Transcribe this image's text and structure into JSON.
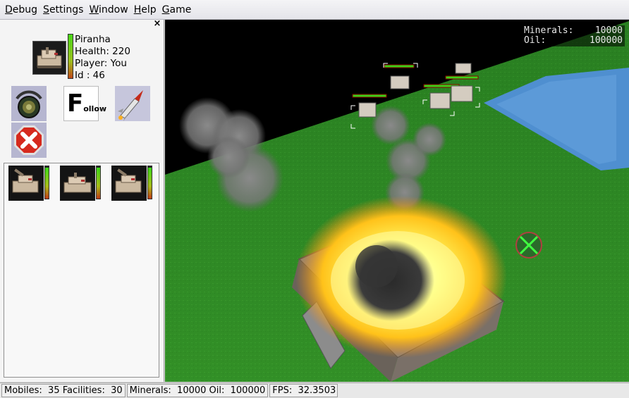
{
  "menu": [
    {
      "key": "D",
      "rest": "ebug"
    },
    {
      "key": "S",
      "rest": "ettings"
    },
    {
      "key": "W",
      "rest": "indow"
    },
    {
      "key": "H",
      "rest": "elp"
    },
    {
      "key": "G",
      "rest": "ame"
    }
  ],
  "panel": {
    "close_label": "×",
    "unit_name": "Piranha",
    "health_line": "Health: 220",
    "player_line": "Player: You",
    "id_line": "Id : 46",
    "health_fraction": 1.0,
    "follow_big": "F",
    "follow_small": "ollow",
    "list_health": [
      0.95,
      0.95,
      0.95
    ]
  },
  "overlay": {
    "minerals_label": "Minerals:",
    "minerals_value": "10000",
    "oil_label": "Oil:",
    "oil_value": "100000"
  },
  "status": {
    "units": "Mobiles:  35 Facilities:  30",
    "resources": "Minerals:  10000 Oil:  100000",
    "fps": "FPS:  32.3503"
  },
  "colors": {
    "grass": "#2e8a24",
    "water": "#4f8fd0",
    "fire": "#ffd21e",
    "smoke": "#7c7c7c"
  }
}
